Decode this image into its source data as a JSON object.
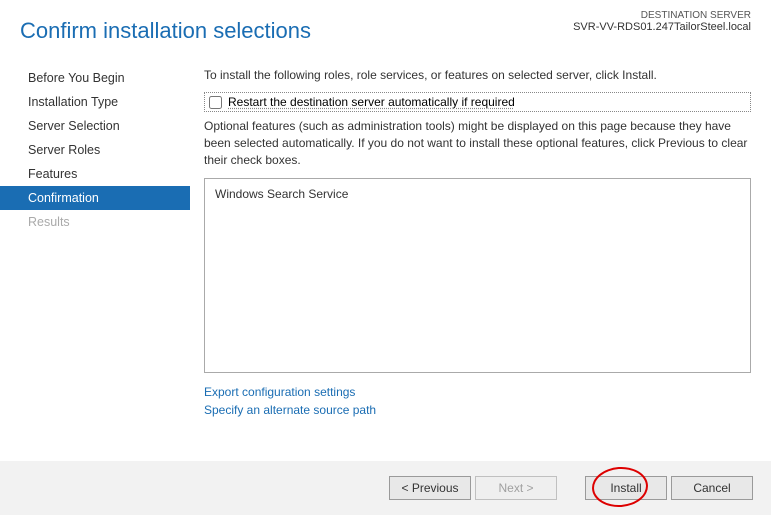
{
  "header": {
    "title": "Confirm installation selections",
    "dest_label": "DESTINATION SERVER",
    "dest_server": "SVR-VV-RDS01.247TailorSteel.local"
  },
  "sidebar": {
    "items": [
      "Before You Begin",
      "Installation Type",
      "Server Selection",
      "Server Roles",
      "Features",
      "Confirmation",
      "Results"
    ]
  },
  "content": {
    "intro": "To install the following roles, role services, or features on selected server, click Install.",
    "restart_label": "Restart the destination server automatically if required",
    "optional": "Optional features (such as administration tools) might be displayed on this page because they have been selected automatically. If you do not want to install these optional features, click Previous to clear their check boxes.",
    "features": [
      "Windows Search Service"
    ],
    "link_export": "Export configuration settings",
    "link_path": "Specify an alternate source path"
  },
  "footer": {
    "previous": "< Previous",
    "next": "Next >",
    "install": "Install",
    "cancel": "Cancel"
  }
}
